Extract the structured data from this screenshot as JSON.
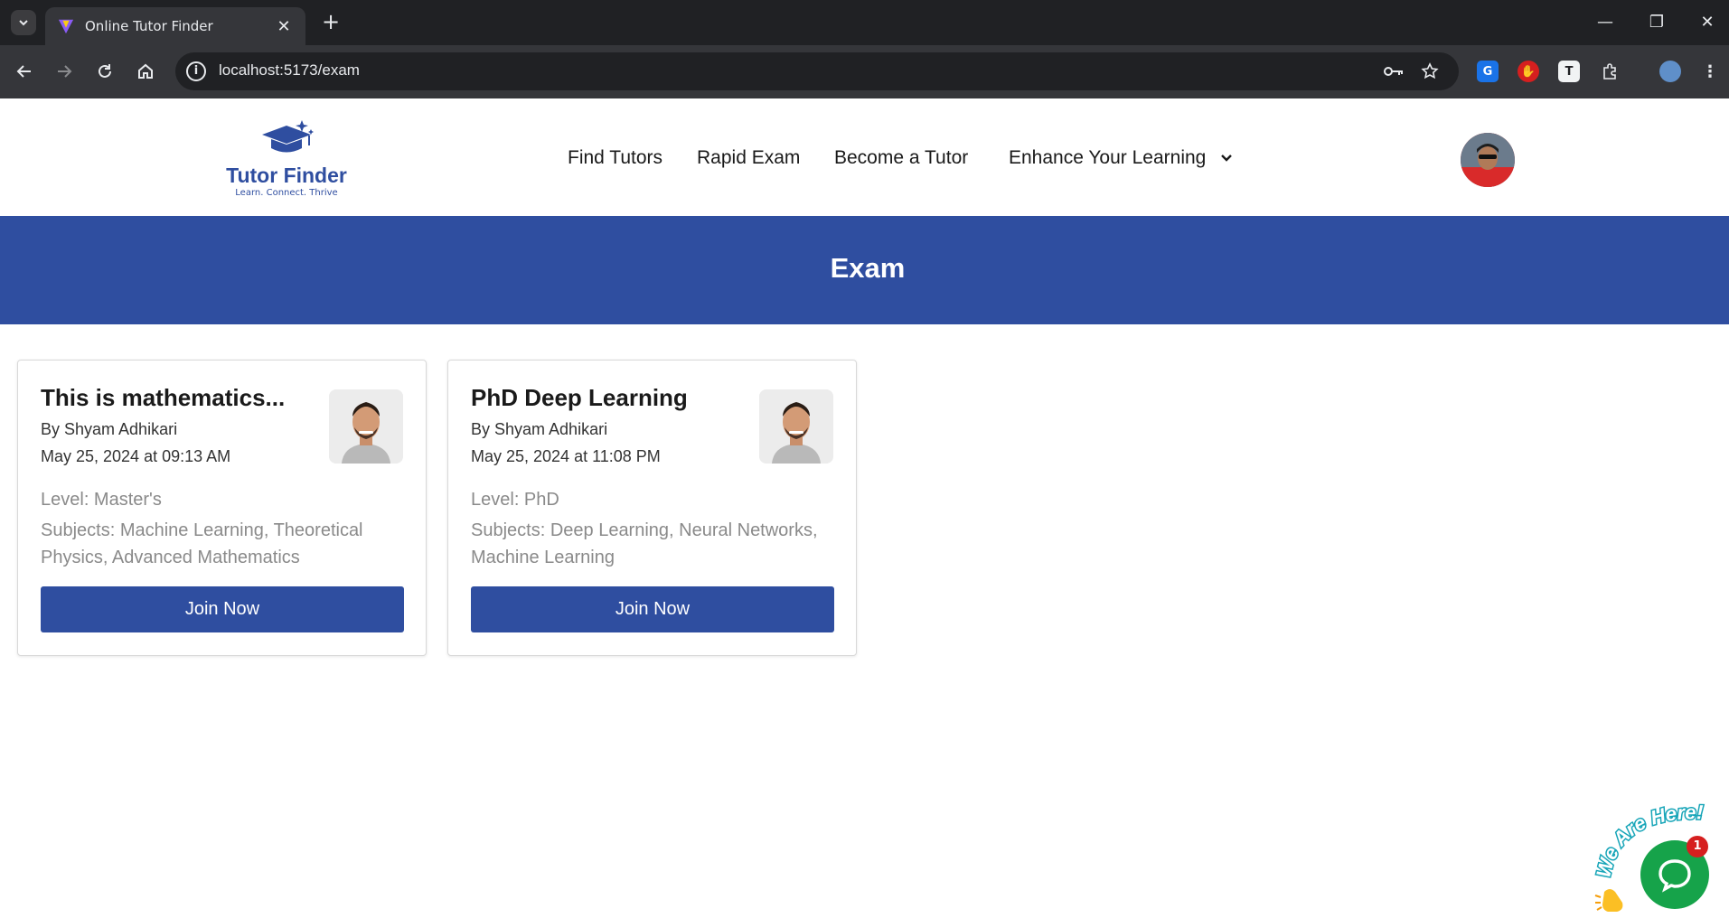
{
  "browser": {
    "tab_title": "Online Tutor Finder",
    "tab_close": "✕",
    "new_tab": "+",
    "url": "localhost:5173/exam",
    "window_controls": {
      "minimize": "—",
      "restore": "❐",
      "close": "✕"
    }
  },
  "header": {
    "logo_name": "Tutor Finder",
    "logo_tagline": "Learn. Connect. Thrive",
    "nav": [
      {
        "label": "Find Tutors"
      },
      {
        "label": "Rapid Exam"
      },
      {
        "label": "Become a Tutor"
      },
      {
        "label": "Enhance Your Learning"
      }
    ]
  },
  "banner": {
    "title": "Exam"
  },
  "exams": [
    {
      "title": "This is mathematics...",
      "author": "By Shyam Adhikari",
      "date": "May 25, 2024 at 09:13 AM",
      "level": "Level: Master's",
      "subjects": "Subjects: Machine Learning, Theoretical Physics, Advanced Mathematics",
      "button": "Join Now"
    },
    {
      "title": "PhD Deep Learning",
      "author": "By Shyam Adhikari",
      "date": "May 25, 2024 at 11:08 PM",
      "level": "Level: PhD",
      "subjects": "Subjects: Deep Learning, Neural Networks, Machine Learning",
      "button": "Join Now"
    }
  ],
  "chat_widget": {
    "caption": "We Are Here!",
    "badge": "1"
  },
  "colors": {
    "brand": "#2f4ea0",
    "chrome_dark": "#202124",
    "chrome_toolbar": "#35363a",
    "chat_green": "#16a34a",
    "badge_red": "#d61f1f"
  }
}
